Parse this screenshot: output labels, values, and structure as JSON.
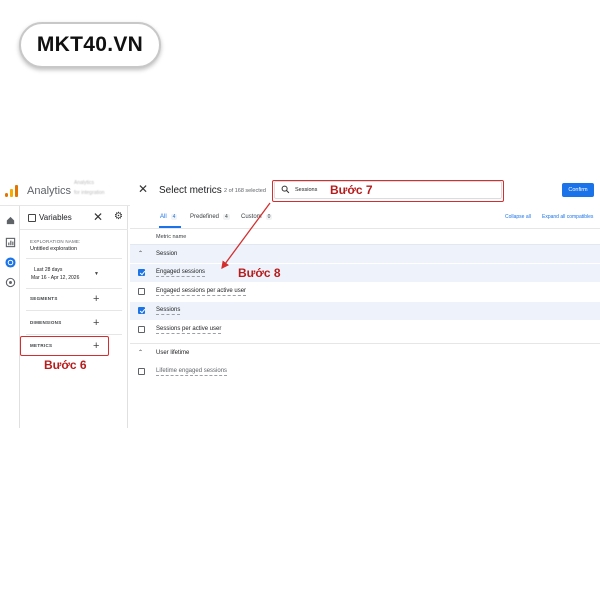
{
  "brand": "MKT40.VN",
  "app": {
    "title": "Analytics",
    "account_line1": "Analytics",
    "account_line2": "for integration"
  },
  "rail_icons": [
    "home-icon",
    "reports-icon",
    "explore-icon",
    "advertising-icon"
  ],
  "variables": {
    "title": "Variables",
    "exploration_label": "EXPLORATION NAME:",
    "exploration_name": "Untitled exploration",
    "date_range_label": "Last 28 days",
    "date_range_values": "Mar 16 - Apr 12, 2026",
    "segments_label": "SEGMENTS",
    "dimensions_label": "DIMENSIONS",
    "metrics_label": "METRICS"
  },
  "dialog": {
    "title": "Select metrics",
    "count": "2 of 168 selected",
    "search_value": "Sessions",
    "confirm_label": "Confirm",
    "tabs": [
      {
        "label": "All",
        "count": "4"
      },
      {
        "label": "Predefined",
        "count": "4"
      },
      {
        "label": "Custom",
        "count": "0"
      }
    ],
    "collapse_all": "Collapse all",
    "expand_all": "Expand all compatibles",
    "column_header": "Metric name",
    "groups": [
      {
        "name": "Session",
        "metrics": [
          {
            "name": "Engaged sessions",
            "checked": true
          },
          {
            "name": "Engaged sessions per active user",
            "checked": false
          },
          {
            "name": "Sessions",
            "checked": true
          },
          {
            "name": "Sessions per active user",
            "checked": false
          }
        ]
      },
      {
        "name": "User lifetime",
        "metrics": [
          {
            "name": "Lifetime engaged sessions",
            "checked": false
          }
        ]
      }
    ]
  },
  "annotations": {
    "step6": "Bước 6",
    "step7": "Bước 7",
    "step8": "Bước 8",
    "color": "#d32f2f"
  }
}
